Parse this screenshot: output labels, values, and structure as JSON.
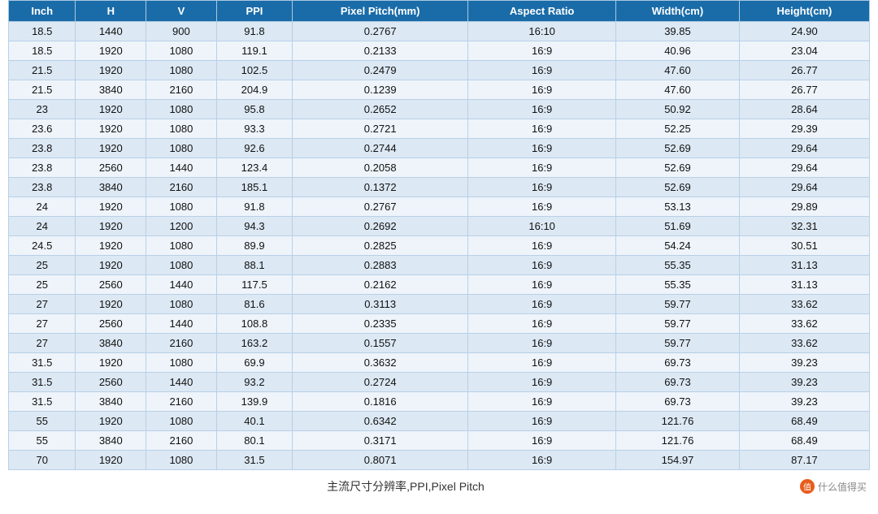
{
  "table": {
    "headers": [
      "Inch",
      "H",
      "V",
      "PPI",
      "Pixel Pitch(mm)",
      "Aspect Ratio",
      "Width(cm)",
      "Height(cm)"
    ],
    "rows": [
      [
        "18.5",
        "1440",
        "900",
        "91.8",
        "0.2767",
        "16:10",
        "39.85",
        "24.90"
      ],
      [
        "18.5",
        "1920",
        "1080",
        "119.1",
        "0.2133",
        "16:9",
        "40.96",
        "23.04"
      ],
      [
        "21.5",
        "1920",
        "1080",
        "102.5",
        "0.2479",
        "16:9",
        "47.60",
        "26.77"
      ],
      [
        "21.5",
        "3840",
        "2160",
        "204.9",
        "0.1239",
        "16:9",
        "47.60",
        "26.77"
      ],
      [
        "23",
        "1920",
        "1080",
        "95.8",
        "0.2652",
        "16:9",
        "50.92",
        "28.64"
      ],
      [
        "23.6",
        "1920",
        "1080",
        "93.3",
        "0.2721",
        "16:9",
        "52.25",
        "29.39"
      ],
      [
        "23.8",
        "1920",
        "1080",
        "92.6",
        "0.2744",
        "16:9",
        "52.69",
        "29.64"
      ],
      [
        "23.8",
        "2560",
        "1440",
        "123.4",
        "0.2058",
        "16:9",
        "52.69",
        "29.64"
      ],
      [
        "23.8",
        "3840",
        "2160",
        "185.1",
        "0.1372",
        "16:9",
        "52.69",
        "29.64"
      ],
      [
        "24",
        "1920",
        "1080",
        "91.8",
        "0.2767",
        "16:9",
        "53.13",
        "29.89"
      ],
      [
        "24",
        "1920",
        "1200",
        "94.3",
        "0.2692",
        "16:10",
        "51.69",
        "32.31"
      ],
      [
        "24.5",
        "1920",
        "1080",
        "89.9",
        "0.2825",
        "16:9",
        "54.24",
        "30.51"
      ],
      [
        "25",
        "1920",
        "1080",
        "88.1",
        "0.2883",
        "16:9",
        "55.35",
        "31.13"
      ],
      [
        "25",
        "2560",
        "1440",
        "117.5",
        "0.2162",
        "16:9",
        "55.35",
        "31.13"
      ],
      [
        "27",
        "1920",
        "1080",
        "81.6",
        "0.3113",
        "16:9",
        "59.77",
        "33.62"
      ],
      [
        "27",
        "2560",
        "1440",
        "108.8",
        "0.2335",
        "16:9",
        "59.77",
        "33.62"
      ],
      [
        "27",
        "3840",
        "2160",
        "163.2",
        "0.1557",
        "16:9",
        "59.77",
        "33.62"
      ],
      [
        "31.5",
        "1920",
        "1080",
        "69.9",
        "0.3632",
        "16:9",
        "69.73",
        "39.23"
      ],
      [
        "31.5",
        "2560",
        "1440",
        "93.2",
        "0.2724",
        "16:9",
        "69.73",
        "39.23"
      ],
      [
        "31.5",
        "3840",
        "2160",
        "139.9",
        "0.1816",
        "16:9",
        "69.73",
        "39.23"
      ],
      [
        "55",
        "1920",
        "1080",
        "40.1",
        "0.6342",
        "16:9",
        "121.76",
        "68.49"
      ],
      [
        "55",
        "3840",
        "2160",
        "80.1",
        "0.3171",
        "16:9",
        "121.76",
        "68.49"
      ],
      [
        "70",
        "1920",
        "1080",
        "31.5",
        "0.8071",
        "16:9",
        "154.97",
        "87.17"
      ]
    ]
  },
  "footer": {
    "text": "主流尺寸分辨率,PPI,Pixel Pitch",
    "brand": "值 什么值得买"
  }
}
